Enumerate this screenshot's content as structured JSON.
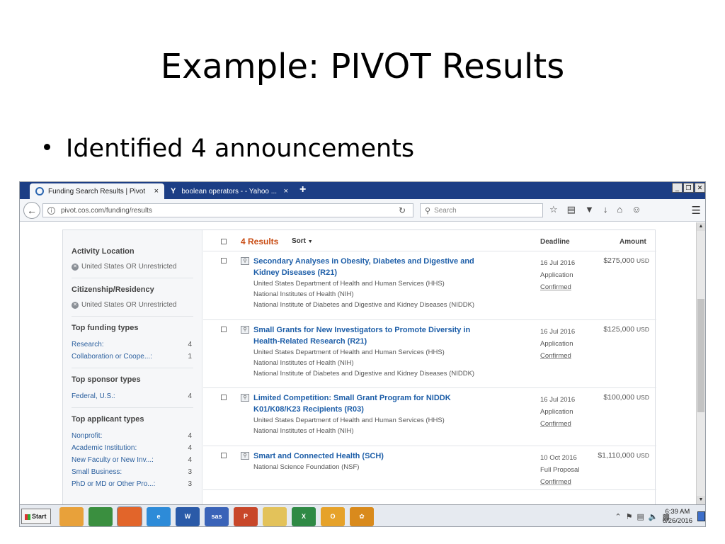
{
  "slide": {
    "title": "Example:  PIVOT Results",
    "bullet": "Identified 4 announcements"
  },
  "browser": {
    "tabs": [
      {
        "label": "Funding Search Results | Pivot",
        "close": "×",
        "icon": "pivot-icon"
      },
      {
        "label": "boolean operators - - Yahoo ...",
        "close": "×",
        "icon": "yahoo-icon",
        "icon_text": "Y"
      }
    ],
    "new_tab": "+",
    "window_buttons": [
      "_",
      "❐",
      "✕"
    ],
    "url": "pivot.cos.com/funding/results",
    "search_placeholder": "Search"
  },
  "sidebar": {
    "facets": [
      {
        "title": "Activity Location",
        "chip": "United States OR Unrestricted"
      },
      {
        "title": "Citizenship/Residency",
        "chip": "United States OR Unrestricted"
      },
      {
        "title": "Top funding types",
        "rows": [
          {
            "label": "Research:",
            "count": "4"
          },
          {
            "label": "Collaboration or Coope...:",
            "count": "1"
          }
        ]
      },
      {
        "title": "Top sponsor types",
        "rows": [
          {
            "label": "Federal, U.S.:",
            "count": "4"
          }
        ]
      },
      {
        "title": "Top applicant types",
        "rows": [
          {
            "label": "Nonprofit:",
            "count": "4"
          },
          {
            "label": "Academic Institution:",
            "count": "4"
          },
          {
            "label": "New Faculty or New Inv...:",
            "count": "4"
          },
          {
            "label": "Small Business:",
            "count": "3"
          },
          {
            "label": "PhD or MD or Other Pro...:",
            "count": "3"
          }
        ]
      }
    ]
  },
  "results": {
    "count_label": "4 Results",
    "sort_label": "Sort",
    "deadline_header": "Deadline",
    "amount_header": "Amount",
    "items": [
      {
        "title_line1": "Secondary Analyses in Obesity, Diabetes and Digestive and",
        "title_line2": "Kidney Diseases (R21)",
        "sub": [
          "United States Department of Health and Human Services (HHS)",
          "National Institutes of Health (NIH)",
          "National Institute of Diabetes and Digestive and Kidney Diseases (NIDDK)"
        ],
        "date": "16 Jul 2016",
        "deadline_type": "Application",
        "status": "Confirmed",
        "amount": "$275,000",
        "currency": "USD"
      },
      {
        "title_line1": "Small Grants for New Investigators to Promote Diversity in",
        "title_line2": "Health-Related Research (R21)",
        "sub": [
          "United States Department of Health and Human Services (HHS)",
          "National Institutes of Health (NIH)",
          "National Institute of Diabetes and Digestive and Kidney Diseases (NIDDK)"
        ],
        "date": "16 Jul 2016",
        "deadline_type": "Application",
        "status": "Confirmed",
        "amount": "$125,000",
        "currency": "USD"
      },
      {
        "title_line1": "Limited Competition: Small Grant Program for NIDDK",
        "title_line2": "K01/K08/K23 Recipients (R03)",
        "sub": [
          "United States Department of Health and Human Services (HHS)",
          "National Institutes of Health (NIH)"
        ],
        "date": "16 Jul 2016",
        "deadline_type": "Application",
        "status": "Confirmed",
        "amount": "$100,000",
        "currency": "USD"
      },
      {
        "title_line1": "Smart and Connected Health (SCH)",
        "title_line2": "",
        "sub": [
          "National Science Foundation (NSF)"
        ],
        "date": "10 Oct 2016",
        "deadline_type": "Full Proposal",
        "status": "Confirmed",
        "amount": "$1,110,000",
        "currency": "USD"
      }
    ]
  },
  "taskbar": {
    "start_label": "Start",
    "apps": [
      {
        "name": "outlook-express-icon",
        "text": "",
        "color": "#e8a13a"
      },
      {
        "name": "chrome-icon",
        "text": "",
        "color": "#3a8f3f"
      },
      {
        "name": "firefox-icon",
        "text": "",
        "color": "#e2652a"
      },
      {
        "name": "internet-explorer-icon",
        "text": "e",
        "color": "#2d8bd8"
      },
      {
        "name": "word-icon",
        "text": "W",
        "color": "#2a5aa8"
      },
      {
        "name": "sas-icon",
        "text": "sas",
        "color": "#3a63b8"
      },
      {
        "name": "powerpoint-icon",
        "text": "P",
        "color": "#c8472a"
      },
      {
        "name": "folder-icon",
        "text": "",
        "color": "#e3c25a"
      },
      {
        "name": "excel-icon",
        "text": "X",
        "color": "#2f8a45"
      },
      {
        "name": "outlook-icon",
        "text": "O",
        "color": "#e6a22a"
      },
      {
        "name": "flower-app-icon",
        "text": "✿",
        "color": "#d98a1c"
      }
    ],
    "clock_time": "6:39 AM",
    "clock_date": "6/26/2016"
  },
  "colors": {
    "tab_bar": "#1c3e85",
    "link": "#1d5ea8",
    "results_count": "#c84b12"
  }
}
